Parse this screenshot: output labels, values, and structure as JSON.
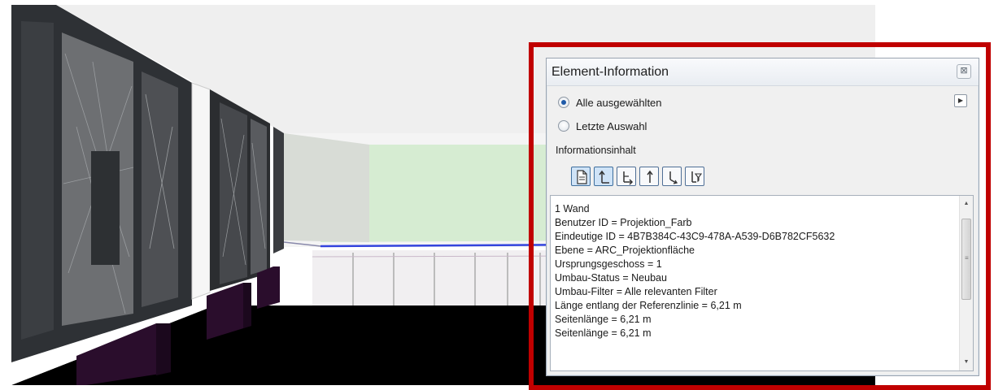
{
  "panel": {
    "title": "Element-Information",
    "close_icon": "close-icon",
    "expand_icon": "play-icon",
    "radio_options": [
      {
        "label": "Alle ausgewählten",
        "checked": true
      },
      {
        "label": "Letzte Auswahl",
        "checked": false
      }
    ],
    "info_heading": "Informationsinhalt",
    "toolbar_icons": [
      {
        "name": "document-icon",
        "active": true
      },
      {
        "name": "parent-icon",
        "active": true
      },
      {
        "name": "children-icon",
        "active": false
      },
      {
        "name": "up-arrow-icon",
        "active": false
      },
      {
        "name": "down-arrow-icon",
        "active": false
      },
      {
        "name": "filter-tree-icon",
        "active": false
      }
    ],
    "info_lines": [
      "1 Wand",
      "Benutzer ID = Projektion_Farb",
      "Eindeutige ID = 4B7B384C-43C9-478A-A539-D6B782CF5632",
      "Ebene = ARC_Projektionfläche",
      "Ursprungsgeschoss = 1",
      "Umbau-Status = Neubau",
      "Umbau-Filter = Alle relevanten Filter",
      "Länge entlang der Referenzlinie = 6,21 m",
      "Seitenlänge = 6,21 m",
      "Seitenlänge = 6,21 m"
    ]
  },
  "colors": {
    "highlight": "#c00000",
    "selected_icon_bg": "#cfe3f7",
    "radiator": "#2a0d2c",
    "projection_wall": "#d4ead0"
  }
}
